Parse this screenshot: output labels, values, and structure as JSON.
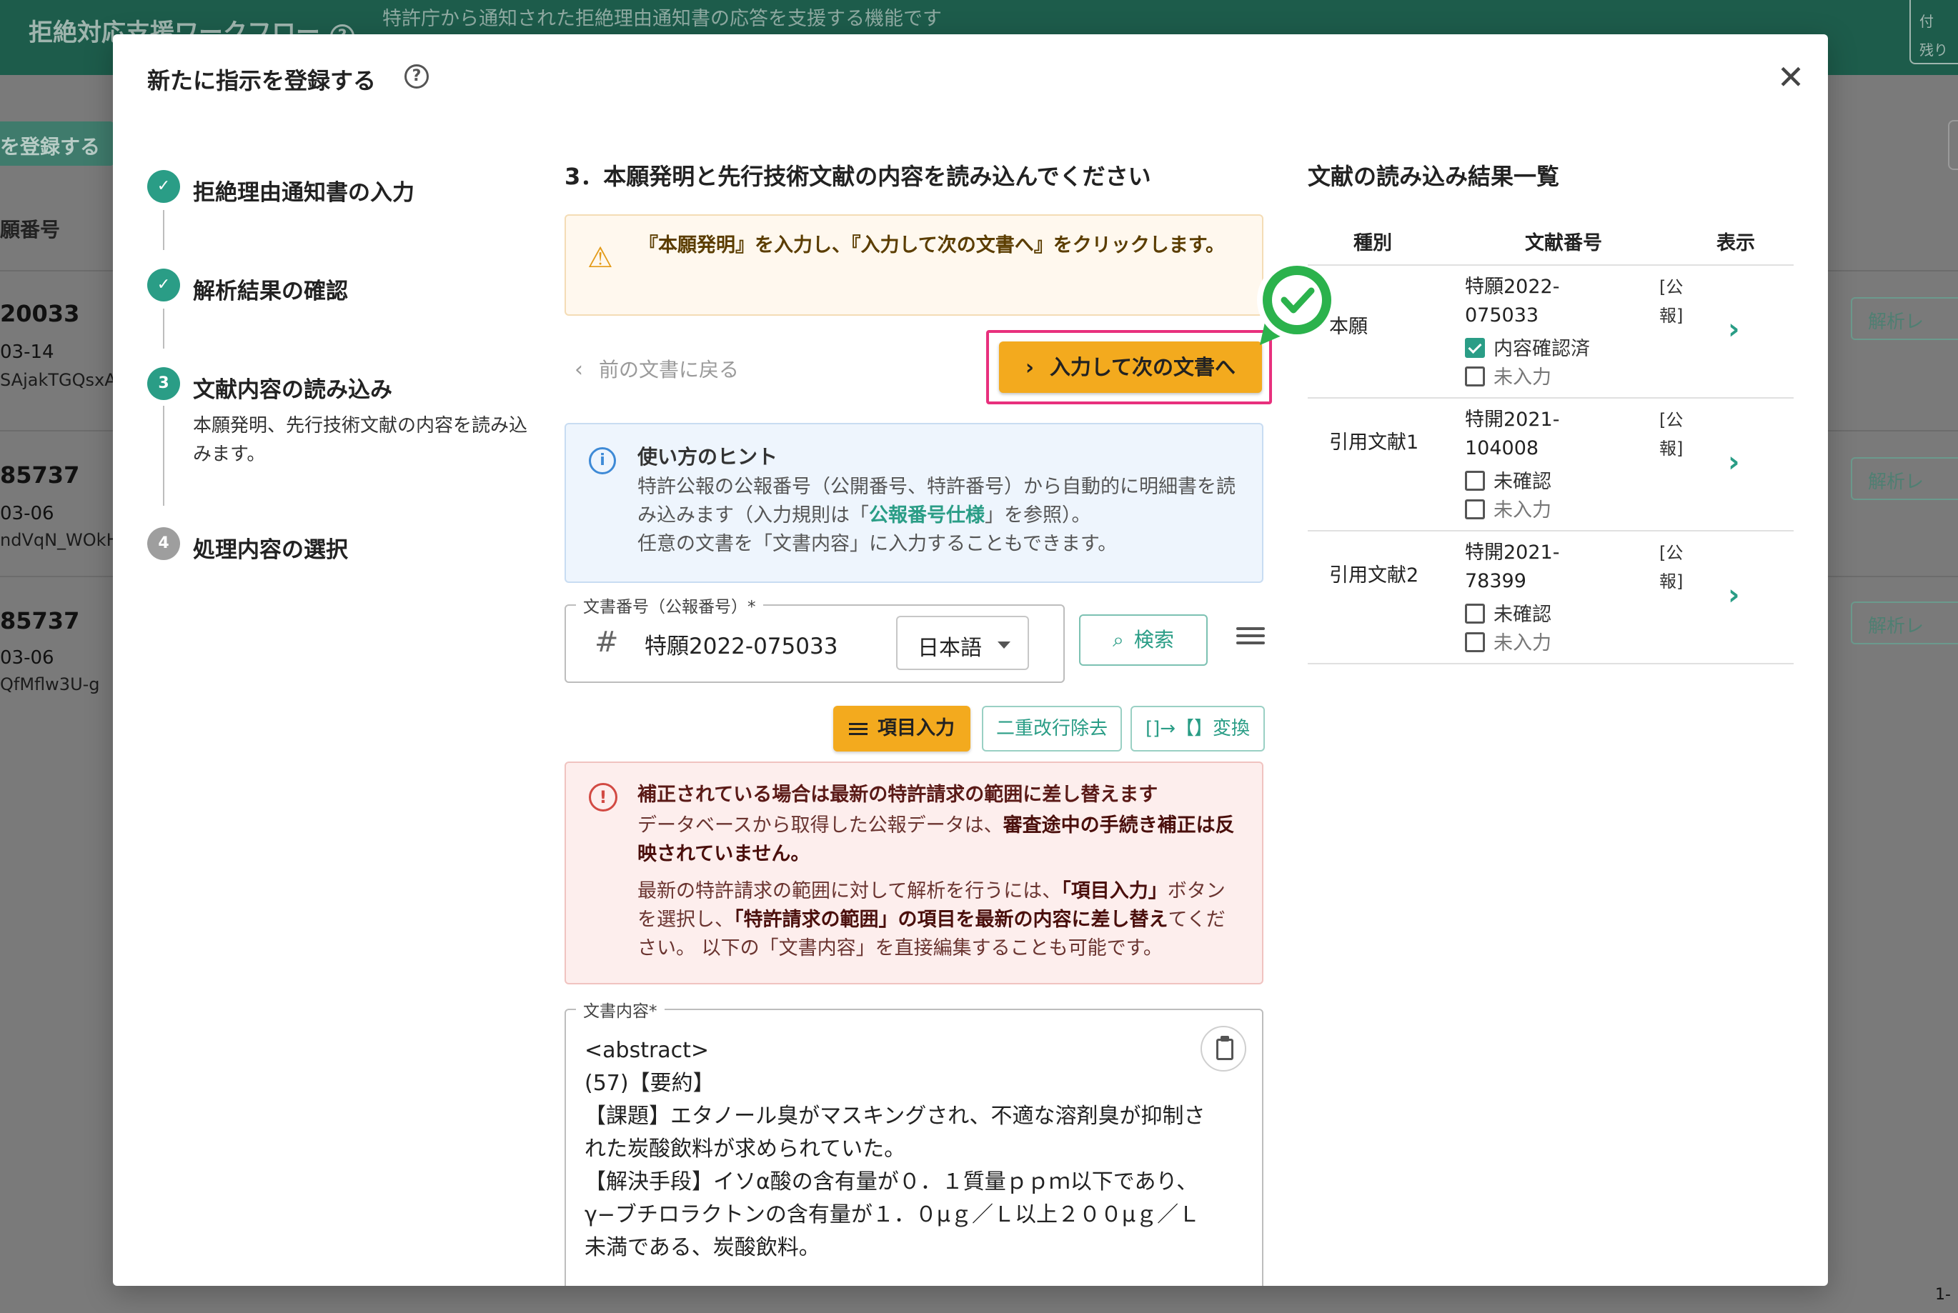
{
  "background": {
    "app_title": "拒絶対応支援ワークフロー",
    "help_glyph": "?",
    "subtitle": "特許庁から通知された拒絶理由通知書の応答を支援する機能です",
    "corner_lines": [
      "付",
      "残り"
    ],
    "register_button": "を登録する",
    "column_header": "願番号",
    "rows": [
      {
        "num": "20033",
        "date": "03-14",
        "code": "SAjakTGQsxA",
        "analyze": "解析レ"
      },
      {
        "num": "85737",
        "date": "03-06",
        "code": "ndVqN_WOkH",
        "analyze": "解析レ"
      },
      {
        "num": "85737",
        "date": "03-06",
        "code": "QfMflw3U-g",
        "analyze": "解析レ"
      }
    ],
    "page_foot": "1-"
  },
  "modal": {
    "title": "新たに指示を登録する",
    "help_glyph": "?",
    "close_glyph": "✕"
  },
  "stepper": {
    "steps": [
      {
        "label": "拒絶理由通知書の入力",
        "state": "done"
      },
      {
        "label": "解析結果の確認",
        "state": "done"
      },
      {
        "label": "文献内容の読み込み",
        "state": "active",
        "number": "3",
        "description": "本願発明、先行技術文献の内容を読み込みます。"
      },
      {
        "label": "処理内容の選択",
        "state": "todo",
        "number": "4"
      }
    ]
  },
  "center": {
    "section_title": "3．本願発明と先行技術文献の内容を読み込んでください",
    "warning_text": "『本願発明』を入力し、『入力して次の文書へ』をクリックします。",
    "back_link": "前の文書に戻る",
    "next_button": "入力して次の文書へ",
    "hint": {
      "title": "使い方のヒント",
      "line1": "特許公報の公報番号（公開番号、特許番号）から自動的に明細書を読み込みます（入力規則は「",
      "link": "公報番号仕様",
      "line1_end": "」を参照）。",
      "line2": "任意の文書を「文書内容」に入力することもできます。"
    },
    "doc_number": {
      "legend": "文書番号（公報番号）*",
      "value": "特願2022-075033",
      "language": "日本語"
    },
    "search_button": "検索",
    "item_input_button": "項目入力",
    "double_newline_button": "二重改行除去",
    "convert_button": "[]→【】変換",
    "error": {
      "title": "補正されている場合は最新の特許請求の範囲に差し替えます",
      "p1_a": "データベースから取得した公報データは、",
      "p1_b": "審査途中の手続き補正は反映されていません。",
      "p2_a": "最新の特許請求の範囲に対して解析を行うには、",
      "p2_b": "「項目入力」",
      "p2_c": "ボタンを選択し、",
      "p2_d": "「特許請求の範囲」の項目を最新の内容に差し替え",
      "p2_e": "てください。 以下の「文書内容」を直接編集することも可能です。"
    },
    "content": {
      "legend": "文書内容*",
      "text": "<abstract>\n(57)【要約】\n【課題】エタノール臭がマスキングされ、不適な溶剤臭が抑制された炭酸飲料が求められていた。\n【解決手段】イソα酸の含有量が０．１質量ｐｐｍ以下であり、γ−ブチロラクトンの含有量が１．０μｇ／Ｌ以上２００μｇ／Ｌ未満である、炭酸飲料。"
    }
  },
  "results": {
    "title": "文献の読み込み結果一覧",
    "headers": {
      "type": "種別",
      "number": "文献番号",
      "view": "表示"
    },
    "rows": [
      {
        "type": "本願",
        "number": "特願2022-075033",
        "pub": "[公報]",
        "check1": "内容確認済",
        "check1_checked": true,
        "check2": "未入力"
      },
      {
        "type": "引用文献1",
        "number": "特開2021-104008",
        "pub": "[公報]",
        "check1": "未確認",
        "check1_checked": false,
        "check2": "未入力"
      },
      {
        "type": "引用文献2",
        "number": "特開2021-78399",
        "pub": "[公報]",
        "check1": "未確認",
        "check1_checked": false,
        "check2": "未入力"
      }
    ]
  },
  "colors": {
    "accent_teal": "#2a9d86",
    "button_orange": "#f3aa1e",
    "highlight_pink": "#e8307d",
    "badge_green": "#2bb24c"
  }
}
